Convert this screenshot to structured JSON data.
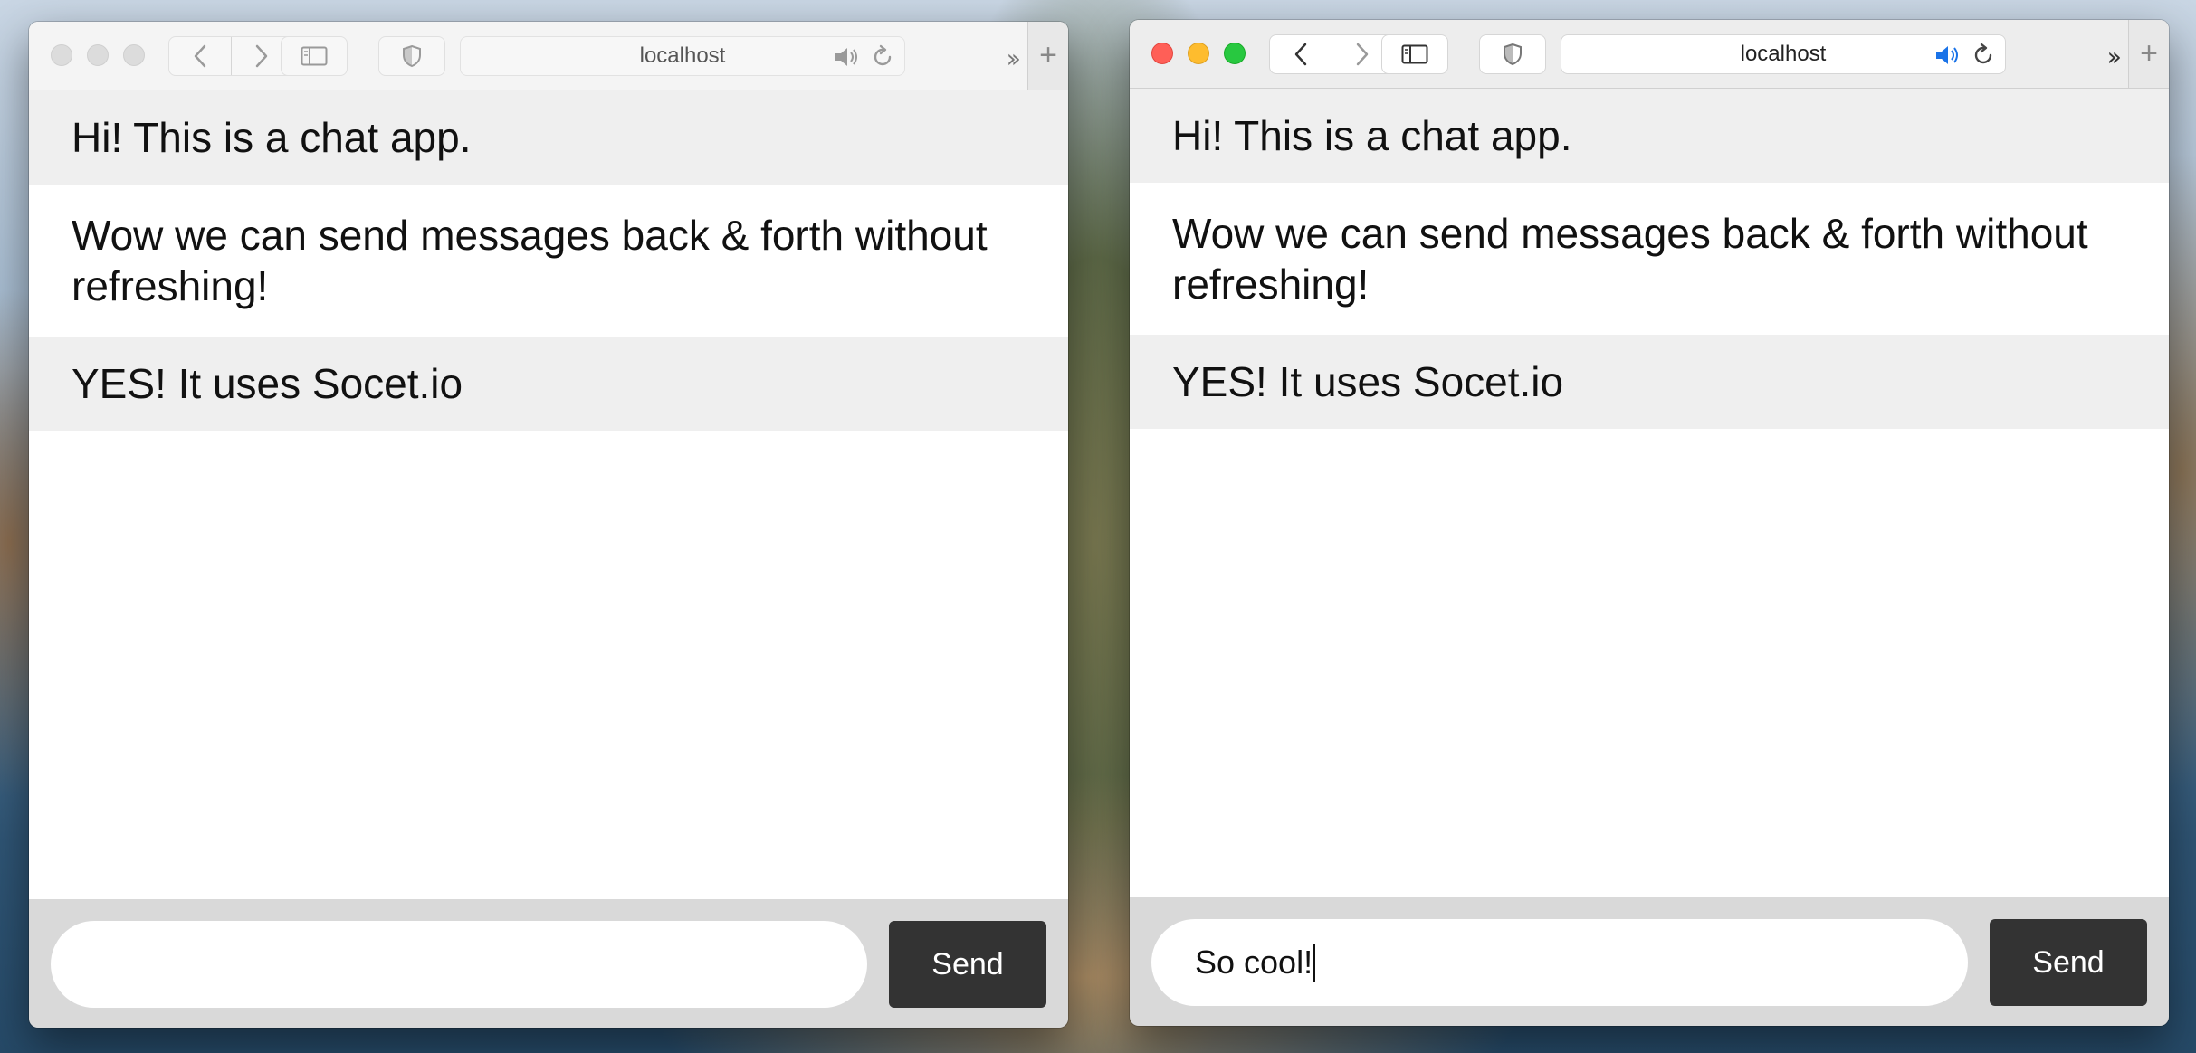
{
  "browser": {
    "url_text": "localhost",
    "overflow_icon": "chevron-double-right-icon",
    "new_tab_icon": "plus-icon"
  },
  "windows": [
    {
      "state": "inactive",
      "messages": [
        "Hi! This is a chat app.",
        "Wow we can send messages back & forth without refreshing!",
        "YES! It uses Socet.io"
      ],
      "composer": {
        "value": "",
        "send_label": "Send"
      }
    },
    {
      "state": "active",
      "messages": [
        "Hi! This is a chat app.",
        "Wow we can send messages back & forth without refreshing!",
        "YES! It uses Socet.io"
      ],
      "composer": {
        "value": "So cool!",
        "send_label": "Send"
      }
    }
  ],
  "colors": {
    "send_button_bg": "#333333",
    "message_stripe_bg": "#efefef",
    "traffic_close": "#ff5f57",
    "traffic_minimize": "#febc2e",
    "traffic_maximize": "#28c840",
    "audio_active": "#1a73e8"
  }
}
